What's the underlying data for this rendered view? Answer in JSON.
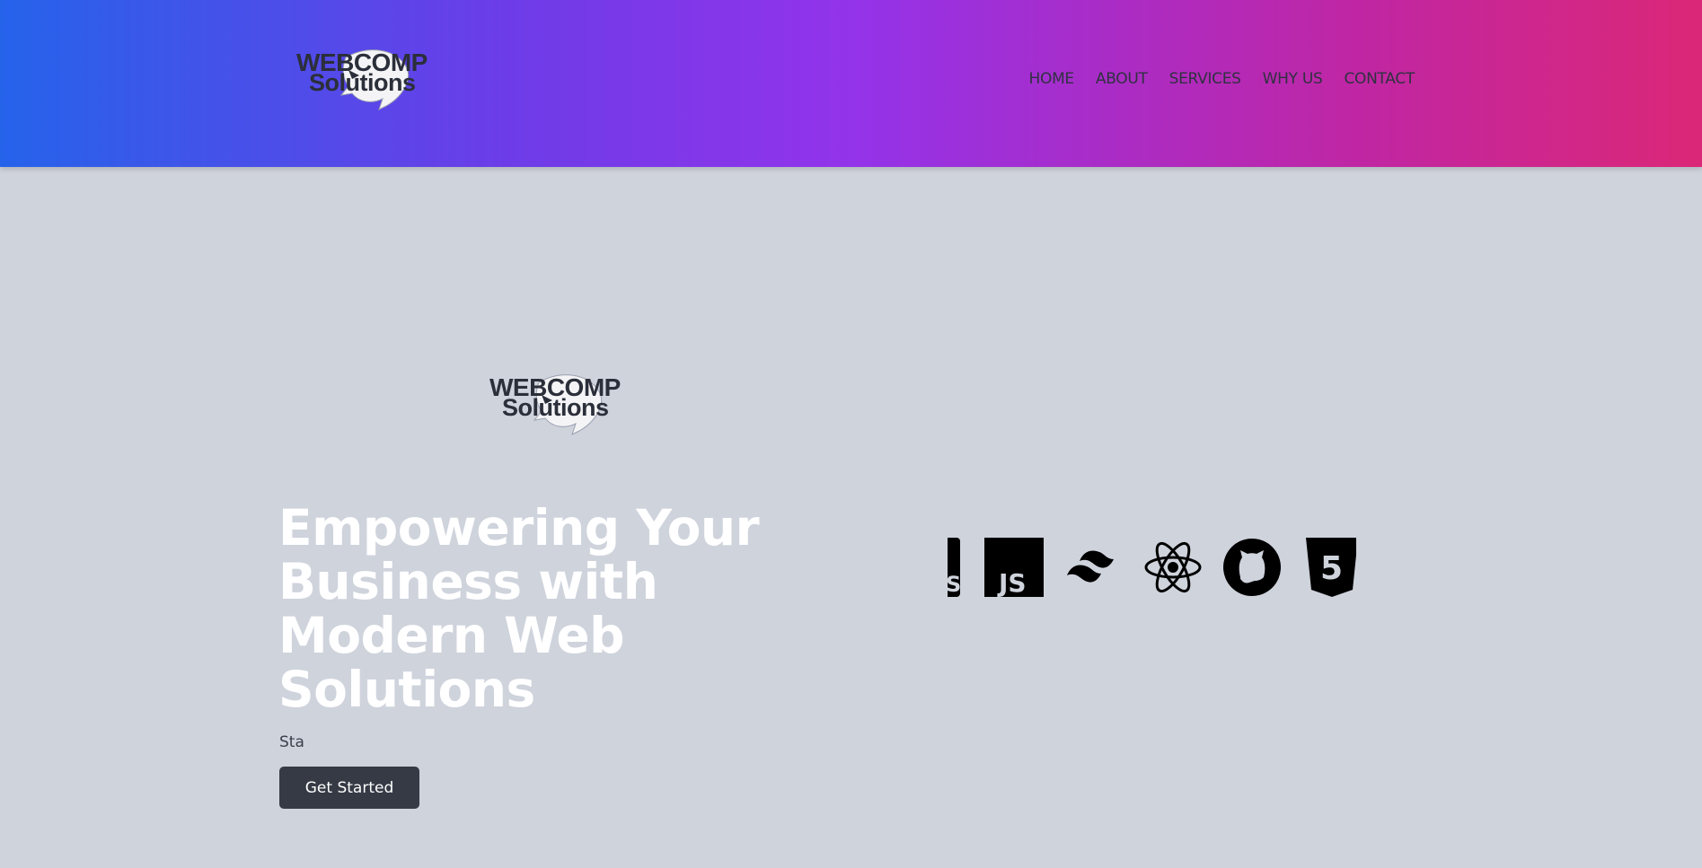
{
  "brand": {
    "logo_line1": "WEBCOMP",
    "logo_line2": "Solutions"
  },
  "nav": {
    "items": [
      {
        "label": "HOME"
      },
      {
        "label": "ABOUT"
      },
      {
        "label": "SERVICES"
      },
      {
        "label": "WHY US"
      },
      {
        "label": "CONTACT"
      }
    ]
  },
  "hero": {
    "title": "Empowering Your Business with Modern Web Solutions",
    "subtitle": "Sta",
    "cta_label": "Get Started"
  },
  "tech_icons": [
    {
      "name": "partial-js-icon"
    },
    {
      "name": "javascript-icon",
      "label": "JS"
    },
    {
      "name": "tailwind-icon"
    },
    {
      "name": "react-icon"
    },
    {
      "name": "github-icon"
    },
    {
      "name": "html5-icon",
      "label": "5"
    }
  ],
  "colors": {
    "header_gradient_start": "#2563eb",
    "header_gradient_end": "#db2777",
    "page_bg": "#cfd3dc",
    "button_bg": "#353a44"
  }
}
